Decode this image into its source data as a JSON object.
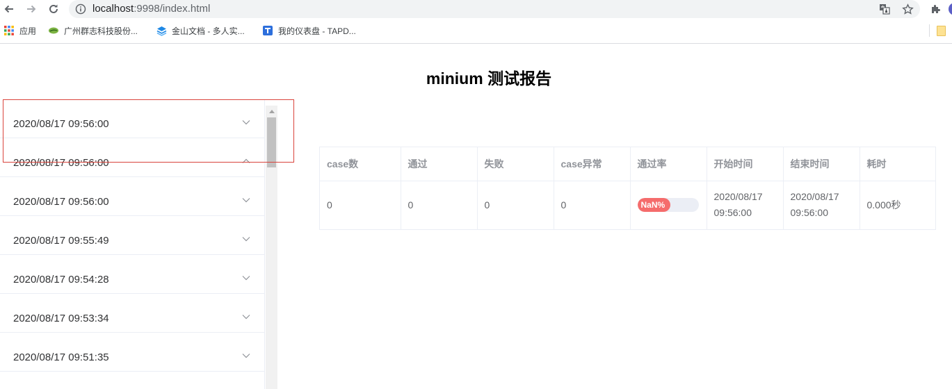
{
  "browser": {
    "url_host": "localhost",
    "url_path": ":9998/index.html",
    "bookmarks": [
      {
        "label": "应用",
        "icon": "apps-grid-icon"
      },
      {
        "label": "广州群志科技股份...",
        "icon": "leaf-icon"
      },
      {
        "label": "金山文档 - 多人实...",
        "icon": "layers-icon"
      },
      {
        "label": "我的仪表盘 - TAPD...",
        "icon": "tapd-icon"
      }
    ]
  },
  "page": {
    "title": "minium 测试报告"
  },
  "sidebar": {
    "items": [
      {
        "label": "2020/08/17 09:56:00",
        "expanded": false
      },
      {
        "label": "2020/08/17 09:56:00",
        "expanded": true
      },
      {
        "label": "2020/08/17 09:56:00",
        "expanded": false
      },
      {
        "label": "2020/08/17 09:55:49",
        "expanded": false
      },
      {
        "label": "2020/08/17 09:54:28",
        "expanded": false
      },
      {
        "label": "2020/08/17 09:53:34",
        "expanded": false
      },
      {
        "label": "2020/08/17 09:51:35",
        "expanded": false
      }
    ]
  },
  "table": {
    "headers": [
      "case数",
      "通过",
      "失败",
      "case异常",
      "通过率",
      "开始时间",
      "结束时间",
      "耗时"
    ],
    "row": {
      "case_count": "0",
      "passed": "0",
      "failed": "0",
      "case_error": "0",
      "pass_rate_text": "NaN%",
      "start_date": "2020/08/17",
      "start_time": "09:56:00",
      "end_date": "2020/08/17",
      "end_time": "09:56:00",
      "duration": "0.000秒"
    }
  },
  "colors": {
    "progress_fill": "#f56c6c",
    "progress_track": "#ebeef5",
    "highlight_border": "#d9433b"
  }
}
